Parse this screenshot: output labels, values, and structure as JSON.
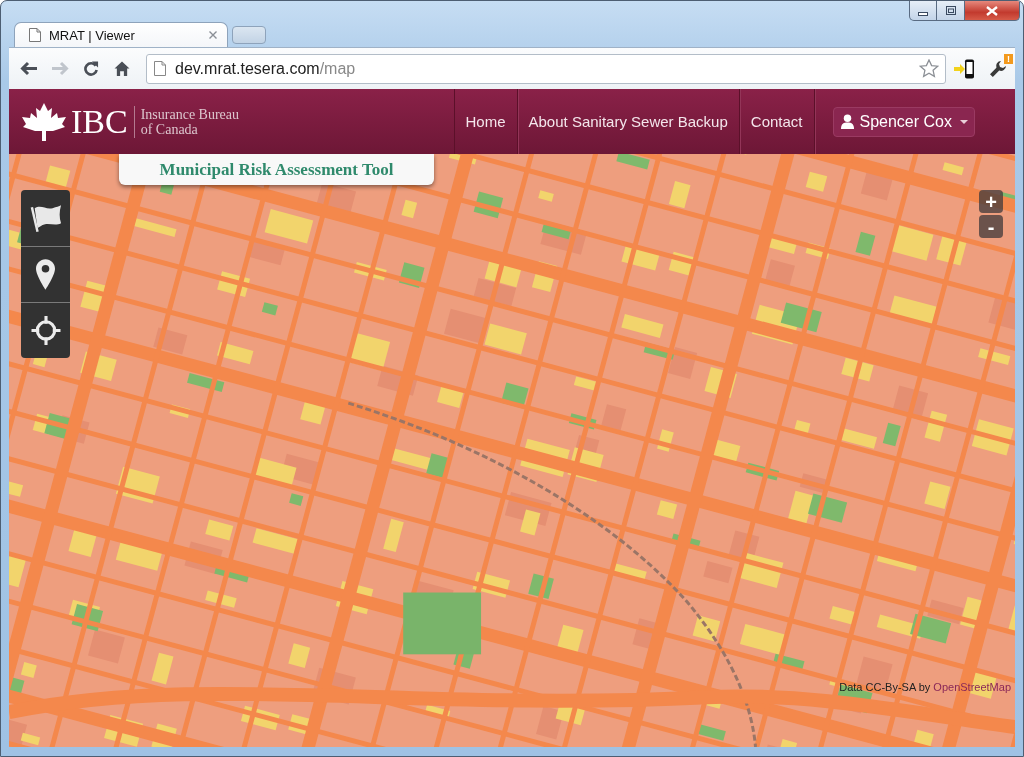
{
  "browser": {
    "tabs": [
      {
        "title": "MRAT | Viewer",
        "selected": true
      }
    ],
    "nav_buttons": [
      {
        "kind": "back",
        "disabled": false
      },
      {
        "kind": "forward",
        "disabled": true
      },
      {
        "kind": "reload",
        "disabled": false
      },
      {
        "kind": "home",
        "disabled": false
      }
    ],
    "address_bar": {
      "host": "dev.mrat.tesera.com",
      "path": "/map"
    },
    "menu_badge": "!"
  },
  "header": {
    "logo": {
      "wordmark": "IBC",
      "name_lines": [
        "Insurance Bureau",
        "of Canada"
      ]
    },
    "nav": [
      "Home",
      "About Sanitary Sewer Backup",
      "Contact"
    ],
    "user_menu": {
      "name": "Spencer Cox"
    }
  },
  "map": {
    "title_tab": "Municipal Risk Assessment Tool",
    "zoom_controls": [
      "+",
      "-"
    ],
    "attribution": {
      "text": "Data CC-By-SA by",
      "link": "OpenStreetMap"
    }
  }
}
